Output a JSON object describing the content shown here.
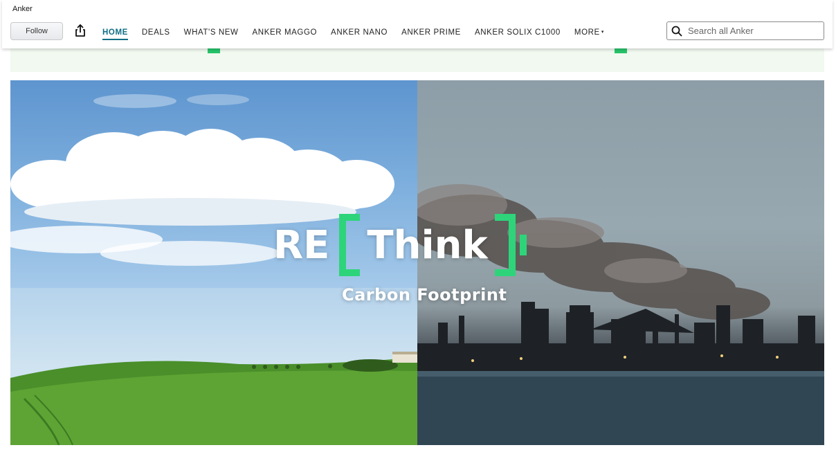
{
  "store": {
    "name": "Anker"
  },
  "header": {
    "follow_label": "Follow",
    "share_icon": "share-icon",
    "nav": [
      {
        "label": "HOME",
        "active": true
      },
      {
        "label": "DEALS",
        "active": false
      },
      {
        "label": "WHAT'S NEW",
        "active": false
      },
      {
        "label": "ANKER MAGGO",
        "active": false
      },
      {
        "label": "ANKER NANO",
        "active": false
      },
      {
        "label": "ANKER PRIME",
        "active": false
      },
      {
        "label": "ANKER SOLIX C1000",
        "active": false
      },
      {
        "label": "MORE",
        "active": false
      }
    ],
    "more_caret": "▾",
    "search": {
      "placeholder": "Search all Anker",
      "value": ""
    }
  },
  "hero": {
    "title_prefix": "RE",
    "title_word": "Think",
    "subtitle": "Carbon Footprint"
  },
  "colors": {
    "accent_green": "#2ed47a",
    "active_nav": "#0f6e84",
    "strip_bg": "#f1f9f0"
  }
}
